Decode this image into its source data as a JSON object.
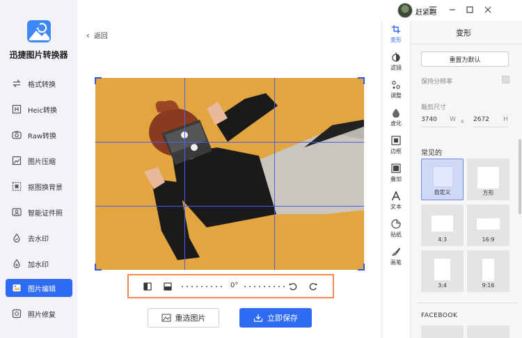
{
  "app": {
    "title": "迅捷图片转换器"
  },
  "sidebar": {
    "items": [
      {
        "label": "格式转换",
        "icon": "convert-icon"
      },
      {
        "label": "Heic转换",
        "icon": "heic-icon"
      },
      {
        "label": "Raw转换",
        "icon": "raw-icon"
      },
      {
        "label": "图片压缩",
        "icon": "compress-icon"
      },
      {
        "label": "抠图换背景",
        "icon": "cutout-icon"
      },
      {
        "label": "智能证件照",
        "icon": "id-photo-icon"
      },
      {
        "label": "去水印",
        "icon": "remove-watermark-icon"
      },
      {
        "label": "加水印",
        "icon": "add-watermark-icon"
      },
      {
        "label": "图片编辑",
        "icon": "edit-icon",
        "active": true
      },
      {
        "label": "照片修复",
        "icon": "repair-icon"
      }
    ]
  },
  "titlebar": {
    "username": "赶紧跑"
  },
  "main": {
    "back_label": "返回",
    "angle": "0°",
    "reselect_label": "重选图片",
    "save_label": "立即保存"
  },
  "tool_rail": {
    "items": [
      {
        "label": "变形",
        "icon": "crop-icon",
        "active": true
      },
      {
        "label": "滤镜",
        "icon": "filter-icon"
      },
      {
        "label": "调整",
        "icon": "adjust-icon"
      },
      {
        "label": "虚化",
        "icon": "blur-icon"
      },
      {
        "label": "边框",
        "icon": "border-icon"
      },
      {
        "label": "叠加",
        "icon": "overlay-icon"
      },
      {
        "label": "文本",
        "icon": "text-icon"
      },
      {
        "label": "贴纸",
        "icon": "sticker-icon"
      },
      {
        "label": "画笔",
        "icon": "brush-icon"
      }
    ]
  },
  "panel": {
    "title": "变形",
    "reset_label": "重置为默认",
    "keep_resolution_label": "保持分辨率",
    "crop_size_label": "裁剪尺寸",
    "width_value": "3740",
    "width_unit": "W",
    "size_separator": "x",
    "height_value": "2672",
    "height_unit": "H",
    "common_label": "常见的",
    "presets": [
      {
        "label": "自定义",
        "active": true
      },
      {
        "label": "方形"
      },
      {
        "label": "4:3"
      },
      {
        "label": "16:9"
      },
      {
        "label": "3:4"
      },
      {
        "label": "9:16"
      }
    ],
    "facebook_label": "FACEBOOK"
  },
  "colors": {
    "accent": "#2f6bf5",
    "toolbar_outline": "#f08a50",
    "grid": "#4a5ef0",
    "photo_bg": "#e2a53f"
  }
}
